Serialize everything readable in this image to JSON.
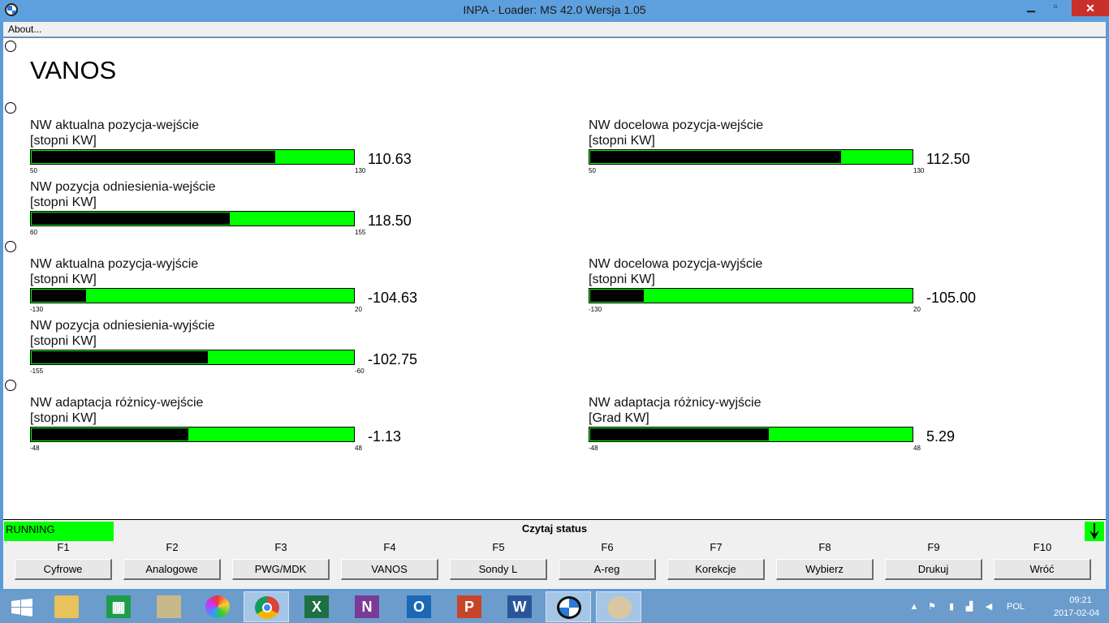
{
  "window": {
    "title": "INPA - Loader:  MS 42.0 Wersja 1.05"
  },
  "menu": {
    "about": "About..."
  },
  "page": {
    "title": "VANOS"
  },
  "gauges": [
    {
      "label": "NW aktualna pozycja-wejście",
      "unit": "[stopni KW]",
      "min": "50",
      "max": "130",
      "value": "110.63",
      "level": 0.758
    },
    {
      "label": "NW docelowa pozycja-wejście",
      "unit": "[stopni KW]",
      "min": "50",
      "max": "130",
      "value": "112.50",
      "level": 0.781
    },
    {
      "label": "NW pozycja odniesienia-wejście",
      "unit": "[stopni KW]",
      "min": "60",
      "max": "155",
      "value": "118.50",
      "level": 0.616
    },
    {
      "label": "NW aktualna pozycja-wyjście",
      "unit": "[stopni KW]",
      "min": "-130",
      "max": "20",
      "value": "-104.63",
      "level": 0.169
    },
    {
      "label": "NW docelowa pozycja-wyjście",
      "unit": "[stopni KW]",
      "min": "-130",
      "max": "20",
      "value": "-105.00",
      "level": 0.167
    },
    {
      "label": "NW pozycja odniesienia-wyjście",
      "unit": "[stopni KW]",
      "min": "-155",
      "max": "-60",
      "value": "-102.75",
      "level": 0.549
    },
    {
      "label": "NW adaptacja różnicy-wejście",
      "unit": "[stopni KW]",
      "min": "-48",
      "max": "48",
      "value": "-1.13",
      "level": 0.488
    },
    {
      "label": "NW adaptacja różnicy-wyjście",
      "unit": "[Grad KW]",
      "min": "-48",
      "max": "48",
      "value": "5.29",
      "level": 0.555
    }
  ],
  "status": {
    "state": "RUNNING",
    "text": "Czytaj status"
  },
  "fkeys": [
    {
      "key": "F1",
      "label": "Cyfrowe"
    },
    {
      "key": "F2",
      "label": "Analogowe"
    },
    {
      "key": "F3",
      "label": "PWG/MDK"
    },
    {
      "key": "F4",
      "label": "VANOS"
    },
    {
      "key": "F5",
      "label": "Sondy L"
    },
    {
      "key": "F6",
      "label": "A-reg"
    },
    {
      "key": "F7",
      "label": "Korekcje"
    },
    {
      "key": "F8",
      "label": "Wybierz"
    },
    {
      "key": "F9",
      "label": "Drukuj"
    },
    {
      "key": "F10",
      "label": "Wróć"
    }
  ],
  "taskbar": {
    "apps": [
      "windows-start",
      "file-explorer",
      "store",
      "notepad-app",
      "color-app",
      "chrome",
      "excel",
      "onenote",
      "outlook",
      "powerpoint",
      "word",
      "bmw-inpa",
      "paint"
    ],
    "lang": "POL",
    "time": "09:21",
    "date": "2017-02-04"
  },
  "colors": {
    "bar_bg": "#00ff00",
    "bar_fill": "#000000",
    "title_bar": "#5ea0dd",
    "close": "#c9302c"
  }
}
